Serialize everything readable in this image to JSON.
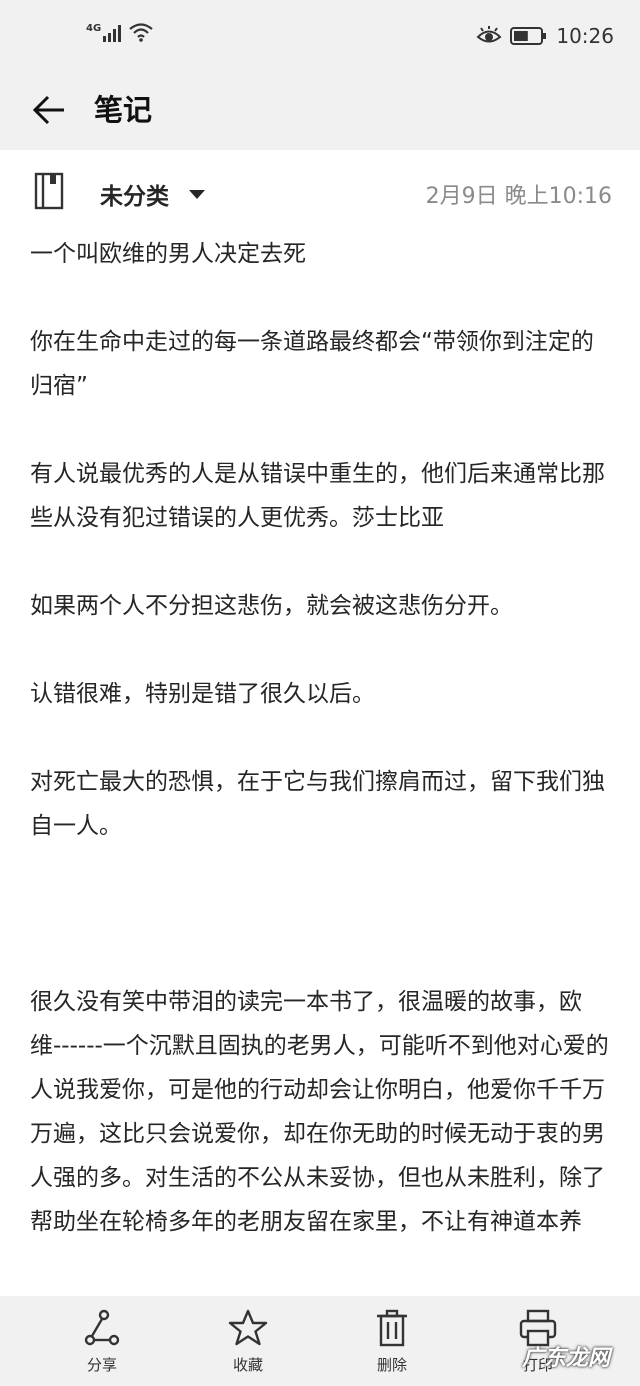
{
  "status_bar": {
    "network": "4G",
    "time": "10:26",
    "battery_level": 0.55,
    "icons": [
      "signal-icon",
      "wifi-icon",
      "eye-comfort-icon",
      "battery-icon"
    ]
  },
  "app_bar": {
    "title": "笔记",
    "back_icon": "back-arrow-icon"
  },
  "meta": {
    "category": "未分类",
    "timestamp": "2月9日 晚上10:16",
    "notebook_icon": "notebook-icon"
  },
  "note": {
    "paragraphs": [
      "一个叫欧维的男人决定去死",
      "你在生命中走过的每一条道路最终都会“带领你到注定的归宿”",
      "有人说最优秀的人是从错误中重生的，他们后来通常比那些从没有犯过错误的人更优秀。莎士比亚",
      "如果两个人不分担这悲伤，就会被这悲伤分开。",
      "认错很难，特别是错了很久以后。",
      "对死亡最大的恐惧，在于它与我们擦肩而过，留下我们独自一人。",
      "很久没有笑中带泪的读完一本书了，很温暖的故事，欧维------一个沉默且固执的老男人，可能听不到他对心爱的人说我爱你，可是他的行动却会让你明白，他爱你千千万万遍，这比只会说爱你，却在你无助的时候无动于衷的男人强的多。对生活的不公从未妥协，但也从未胜利，除了帮助坐在轮椅多年的老朋友留在家里，不让有神道本养"
    ]
  },
  "bottom_bar": {
    "share": "分享",
    "favorite": "收藏",
    "delete": "删除",
    "print": "打印"
  },
  "watermark": "广东龙网",
  "colors": {
    "bar_background": "#f1f1f1",
    "text": "#262626",
    "timestamp": "#8a8a8a"
  }
}
